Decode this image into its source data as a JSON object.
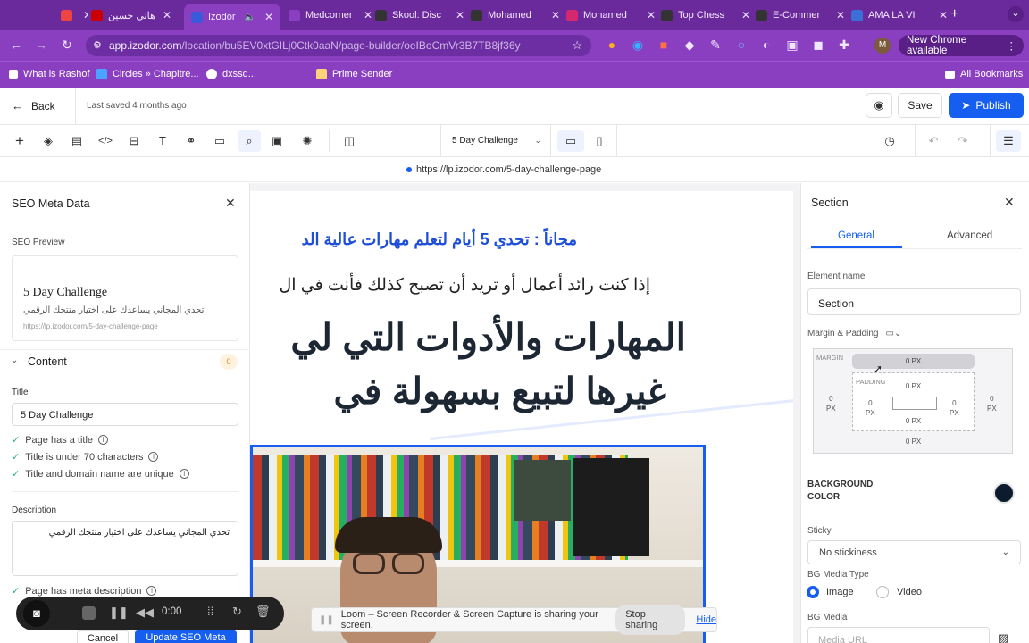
{
  "browser": {
    "tabs": [
      {
        "label": "",
        "color": "#e44"
      },
      {
        "label": "هاني حسين",
        "color": "#c00"
      },
      {
        "label": "Izodor",
        "color": "#3a5bd9"
      },
      {
        "label": "Medcorner",
        "color": "#8a3fc1"
      },
      {
        "label": "Skool: Disc",
        "color": "#333"
      },
      {
        "label": "Mohamed",
        "color": "#333"
      },
      {
        "label": "Mohamed",
        "color": "#d6286f"
      },
      {
        "label": "Top Chess",
        "color": "#333"
      },
      {
        "label": "E-Commer",
        "color": "#333"
      },
      {
        "label": "AMA LA VI",
        "color": "#3b6fd6"
      }
    ],
    "tab_icons": {
      "sk": "sk",
      "izodor": "iz",
      "medcorner": "",
      "mute": "🔈",
      "new_tab": "+",
      "close": "✕",
      "profile": "⌄"
    },
    "url_host": "app.izodor.com",
    "url_path": "/location/bu5EV0xtGILj0Ctk0aaN/page-builder/oeIBoCmVr3B7TB8jf36y",
    "new_chrome": "New Chrome available",
    "profile_initial": "M",
    "bookmarks": [
      "What is Rashof",
      "Circles » Chapitre...",
      "dxssd...",
      "Prime Sender"
    ],
    "all_bookmarks": "All Bookmarks"
  },
  "app": {
    "back": "Back",
    "last_saved": "Last saved 4 months ago",
    "save": "Save",
    "publish": "Publish",
    "page_select": "5 Day Challenge",
    "page_url": "https://lp.izodor.com/5-day-challenge-page"
  },
  "seo": {
    "title": "SEO Meta Data",
    "preview_label": "SEO Preview",
    "preview_title": "5 Day Challenge",
    "preview_desc": "تحدي المجاني يساعدك على اختيار منتجك الرقمي",
    "preview_url": "https://lp.izodor.com/5-day-challenge-page",
    "content_label": "Content",
    "content_count": "0",
    "title_label": "Title",
    "title_value": "5 Day Challenge",
    "checks": [
      "Page has a title",
      "Title is under 70 characters",
      "Title and domain name are unique"
    ],
    "description_label": "Description",
    "description_value": "تحدي المجاني يساعدك على اختيار منتجك الرقمي",
    "check_meta": "Page has meta description",
    "cancel": "Cancel",
    "update": "Update SEO Meta"
  },
  "canvas": {
    "line1": "مجاناً : تحدي 5 أيام لتعلم مهارات عالية الد",
    "line2": "إذا كنت رائد أعمال أو تريد أن تصبح كذلك فأنت في ال",
    "line3": "المهارات والأدوات التي لي",
    "line4": "غيرها لتبيع بسهولة في"
  },
  "section": {
    "title": "Section",
    "tab_general": "General",
    "tab_advanced": "Advanced",
    "element_name_label": "Element name",
    "element_name_value": "Section",
    "margin_padding_label": "Margin & Padding",
    "margin_label": "MARGIN",
    "padding_label": "PADDING",
    "zero": "0",
    "px": "PX",
    "zero_px": "0 PX",
    "bg_color_label": "BACKGROUND COLOR",
    "bg_color": "#0d1b2e",
    "sticky_label": "Sticky",
    "sticky_value": "No stickiness",
    "bg_media_type_label": "BG Media Type",
    "media_image": "Image",
    "media_video": "Video",
    "bg_media_label": "BG Media",
    "media_url_placeholder": "Media URL"
  },
  "loom": {
    "time": "0:00",
    "share_text": "Loom – Screen Recorder & Screen Capture is sharing your screen.",
    "stop": "Stop sharing",
    "hide": "Hide"
  }
}
